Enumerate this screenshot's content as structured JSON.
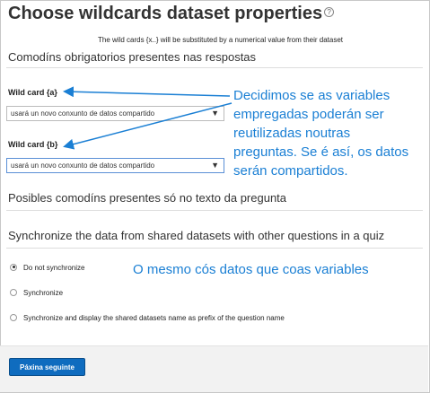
{
  "title": "Choose wildcards dataset properties",
  "help_icon": "question-circle-icon",
  "note": "The wild cards {x..} will be substituted by a numerical value from their dataset",
  "mandatory_heading": "Comodíns obrigatorios presentes nas respostas",
  "wildcards": [
    {
      "label": "Wild card {a}",
      "selected": "usará un novo conxunto de datos compartido"
    },
    {
      "label": "Wild card {b}",
      "selected": "usará un novo conxunto de datos compartido"
    }
  ],
  "possible_heading": "Posibles comodíns presentes só no texto da pregunta",
  "sync_heading": "Synchronize the data from shared datasets with other questions in a quiz",
  "sync_options": [
    {
      "label": "Do not synchronize",
      "checked": true
    },
    {
      "label": "Synchronize",
      "checked": false
    },
    {
      "label": "Synchronize and display the shared datasets name as prefix of the question name",
      "checked": false
    }
  ],
  "next_button": "Páxina seguinte",
  "annotations": {
    "callout1": [
      "Decidimos se as variables",
      "empregadas poderán ser",
      "reutilizadas noutras",
      "preguntas. Se é así, os datos",
      "serán compartidos."
    ],
    "callout2": "O mesmo cós datos que coas variables",
    "color": "#1a7fd4"
  }
}
